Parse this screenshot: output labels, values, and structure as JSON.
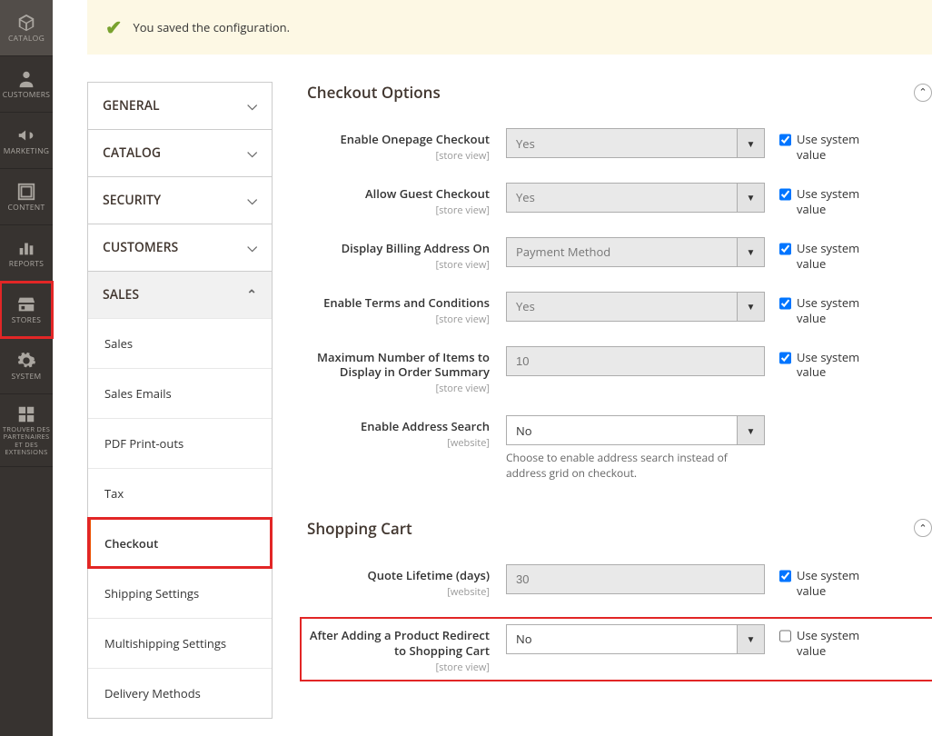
{
  "sidebar": {
    "items": [
      {
        "label": "CATALOG",
        "icon": "cube"
      },
      {
        "label": "CUSTOMERS",
        "icon": "person"
      },
      {
        "label": "MARKETING",
        "icon": "bullhorn"
      },
      {
        "label": "CONTENT",
        "icon": "layout"
      },
      {
        "label": "REPORTS",
        "icon": "barchart"
      },
      {
        "label": "STORES",
        "icon": "storefront",
        "highlighted": true
      },
      {
        "label": "SYSTEM",
        "icon": "gear"
      },
      {
        "label": "TROUVER DES PARTENAIRES ET DES EXTENSIONS",
        "icon": "blocks"
      }
    ]
  },
  "message": {
    "text": "You saved the configuration."
  },
  "config_nav": {
    "sections": [
      {
        "label": "GENERAL",
        "expanded": false
      },
      {
        "label": "CATALOG",
        "expanded": false
      },
      {
        "label": "SECURITY",
        "expanded": false
      },
      {
        "label": "CUSTOMERS",
        "expanded": false
      },
      {
        "label": "SALES",
        "expanded": true,
        "items": [
          {
            "label": "Sales"
          },
          {
            "label": "Sales Emails"
          },
          {
            "label": "PDF Print-outs"
          },
          {
            "label": "Tax"
          },
          {
            "label": "Checkout",
            "active": true,
            "highlighted": true
          },
          {
            "label": "Shipping Settings"
          },
          {
            "label": "Multishipping Settings"
          },
          {
            "label": "Delivery Methods"
          }
        ]
      }
    ]
  },
  "checkout_options": {
    "title": "Checkout Options",
    "fields": {
      "enable_onepage": {
        "label": "Enable Onepage Checkout",
        "scope": "[store view]",
        "value": "Yes",
        "use_system": true
      },
      "allow_guest": {
        "label": "Allow Guest Checkout",
        "scope": "[store view]",
        "value": "Yes",
        "use_system": true
      },
      "display_billing": {
        "label": "Display Billing Address On",
        "scope": "[store view]",
        "value": "Payment Method",
        "use_system": true
      },
      "enable_terms": {
        "label": "Enable Terms and Conditions",
        "scope": "[store view]",
        "value": "Yes",
        "use_system": true
      },
      "max_items": {
        "label": "Maximum Number of Items to Display in Order Summary",
        "scope": "[store view]",
        "value": "10",
        "use_system": true
      },
      "enable_addr_search": {
        "label": "Enable Address Search",
        "scope": "[website]",
        "value": "No",
        "note": "Choose to enable address search instead of address grid on checkout."
      }
    }
  },
  "shopping_cart": {
    "title": "Shopping Cart",
    "fields": {
      "quote_lifetime": {
        "label": "Quote Lifetime (days)",
        "scope": "[website]",
        "value": "30",
        "use_system": true
      },
      "redirect_after_add": {
        "label": "After Adding a Product Redirect to Shopping Cart",
        "scope": "[store view]",
        "value": "No",
        "use_system": false
      }
    }
  },
  "use_system_label": "Use system value"
}
